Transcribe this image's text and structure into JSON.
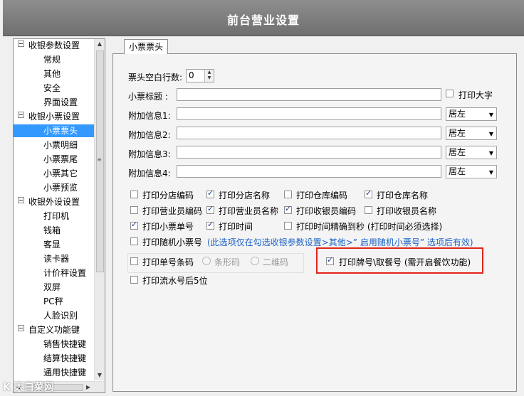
{
  "window": {
    "title": "前台营业设置"
  },
  "tree": {
    "groups": [
      {
        "label": "收银参数设置",
        "items": [
          "常规",
          "其他",
          "安全",
          "界面设置"
        ]
      },
      {
        "label": "收银小票设置",
        "items": [
          "小票票头",
          "小票明细",
          "小票票尾",
          "小票其它",
          "小票预览"
        ]
      },
      {
        "label": "收银外设设置",
        "items": [
          "打印机",
          "钱箱",
          "客显",
          "读卡器",
          "计价秤设置",
          "双屏",
          "PC秤",
          "人脸识别"
        ]
      },
      {
        "label": "自定义功能键",
        "items": [
          "销售快捷键",
          "结算快捷键",
          "通用快捷键"
        ]
      }
    ],
    "selected": "小票票头"
  },
  "tab": {
    "label": "小票票头"
  },
  "form": {
    "blank_lines_label": "票头空白行数:",
    "blank_lines_value": "0",
    "title_label": "小票标题 :",
    "print_large_label": "打印大字",
    "extra1_label": "附加信息1:",
    "extra2_label": "附加信息2:",
    "extra3_label": "附加信息3:",
    "extra4_label": "附加信息4:",
    "align_value": "居左"
  },
  "options": {
    "row1": [
      "打印分店编码",
      "打印分店名称",
      "打印仓库编码",
      "打印仓库名称"
    ],
    "row1_checked": [
      false,
      true,
      false,
      true
    ],
    "row2": [
      "打印营业员编码",
      "打印营业员名称",
      "打印收银员编码",
      "打印收银员名称"
    ],
    "row2_checked": [
      false,
      true,
      true,
      false
    ],
    "row3": [
      "打印小票单号",
      "打印时间",
      "打印时间精确到秒 (打印时间必须选择)"
    ],
    "row3_checked": [
      true,
      true,
      false
    ],
    "random_ticket": "打印随机小票号",
    "random_note": "(此选项仅在勾选收银参数设置>其他>” 启用随机小票号” 选项后有效)",
    "barcode": "打印单号条码",
    "barcode_type1": "条形码",
    "barcode_type2": "二维码",
    "meal_number": "打印牌号\\取餐号 (需开启餐饮功能)",
    "meal_number_checked": true,
    "serial_last5": "打印流水号后5位"
  },
  "watermark": "K 大白菜网"
}
